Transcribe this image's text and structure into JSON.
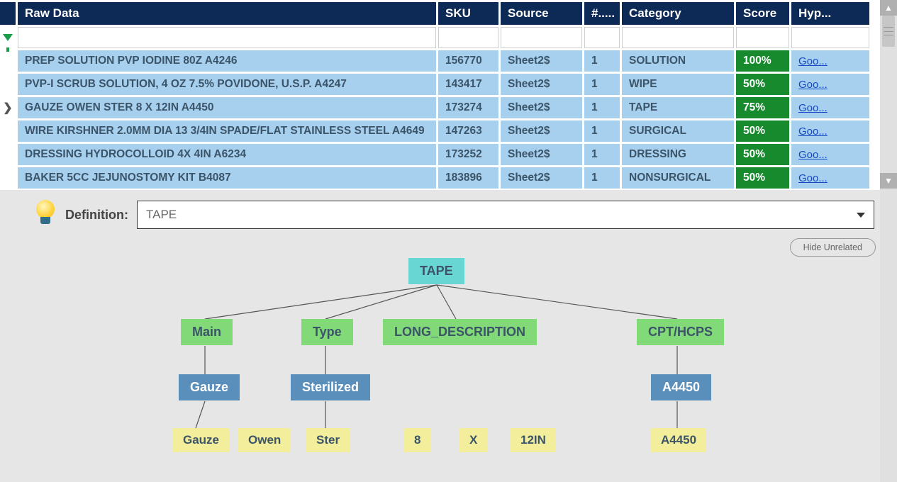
{
  "columns": {
    "raw": "Raw Data",
    "sku": "SKU",
    "source": "Source",
    "count": "#.....",
    "category": "Category",
    "score": "Score",
    "hyp": "Hyp..."
  },
  "rows": [
    {
      "raw": "PREP SOLUTION PVP IODINE 80Z A4246",
      "sku": "156770",
      "source": "Sheet2$",
      "count": "1",
      "category": "SOLUTION",
      "score": "100%",
      "hyp": "Goo..."
    },
    {
      "raw": "PVP-I SCRUB SOLUTION, 4 OZ 7.5% POVIDONE, U.S.P. A4247",
      "sku": "143417",
      "source": "Sheet2$",
      "count": "1",
      "category": "WIPE",
      "score": "50%",
      "hyp": "Goo..."
    },
    {
      "raw": "GAUZE OWEN STER 8 X 12IN A4450",
      "sku": "173274",
      "source": "Sheet2$",
      "count": "1",
      "category": "TAPE",
      "score": "75%",
      "hyp": "Goo...",
      "selected": true
    },
    {
      "raw": "WIRE KIRSHNER 2.0MM DIA 13 3/4IN SPADE/FLAT STAINLESS STEEL A4649",
      "sku": "147263",
      "source": "Sheet2$",
      "count": "1",
      "category": "SURGICAL",
      "score": "50%",
      "hyp": "Goo..."
    },
    {
      "raw": "DRESSING HYDROCOLLOID 4X 4IN A6234",
      "sku": "173252",
      "source": "Sheet2$",
      "count": "1",
      "category": "DRESSING",
      "score": "50%",
      "hyp": "Goo..."
    },
    {
      "raw": "BAKER 5CC JEJUNOSTOMY KIT B4087",
      "sku": "183896",
      "source": "Sheet2$",
      "count": "1",
      "category": "NONSURGICAL",
      "score": "50%",
      "hyp": "Goo..."
    }
  ],
  "definition": {
    "label": "Definition:",
    "value": "TAPE"
  },
  "hide_button": "Hide Unrelated",
  "tree": {
    "root": "TAPE",
    "categories": [
      "Main",
      "Type",
      "LONG_DESCRIPTION",
      "CPT/HCPS"
    ],
    "mids": {
      "main": "Gauze",
      "type": "Sterilized",
      "cpt": "A4450"
    },
    "leaves": [
      "Gauze",
      "Owen",
      "Ster",
      "8",
      "X",
      "12IN",
      "A4450"
    ]
  }
}
